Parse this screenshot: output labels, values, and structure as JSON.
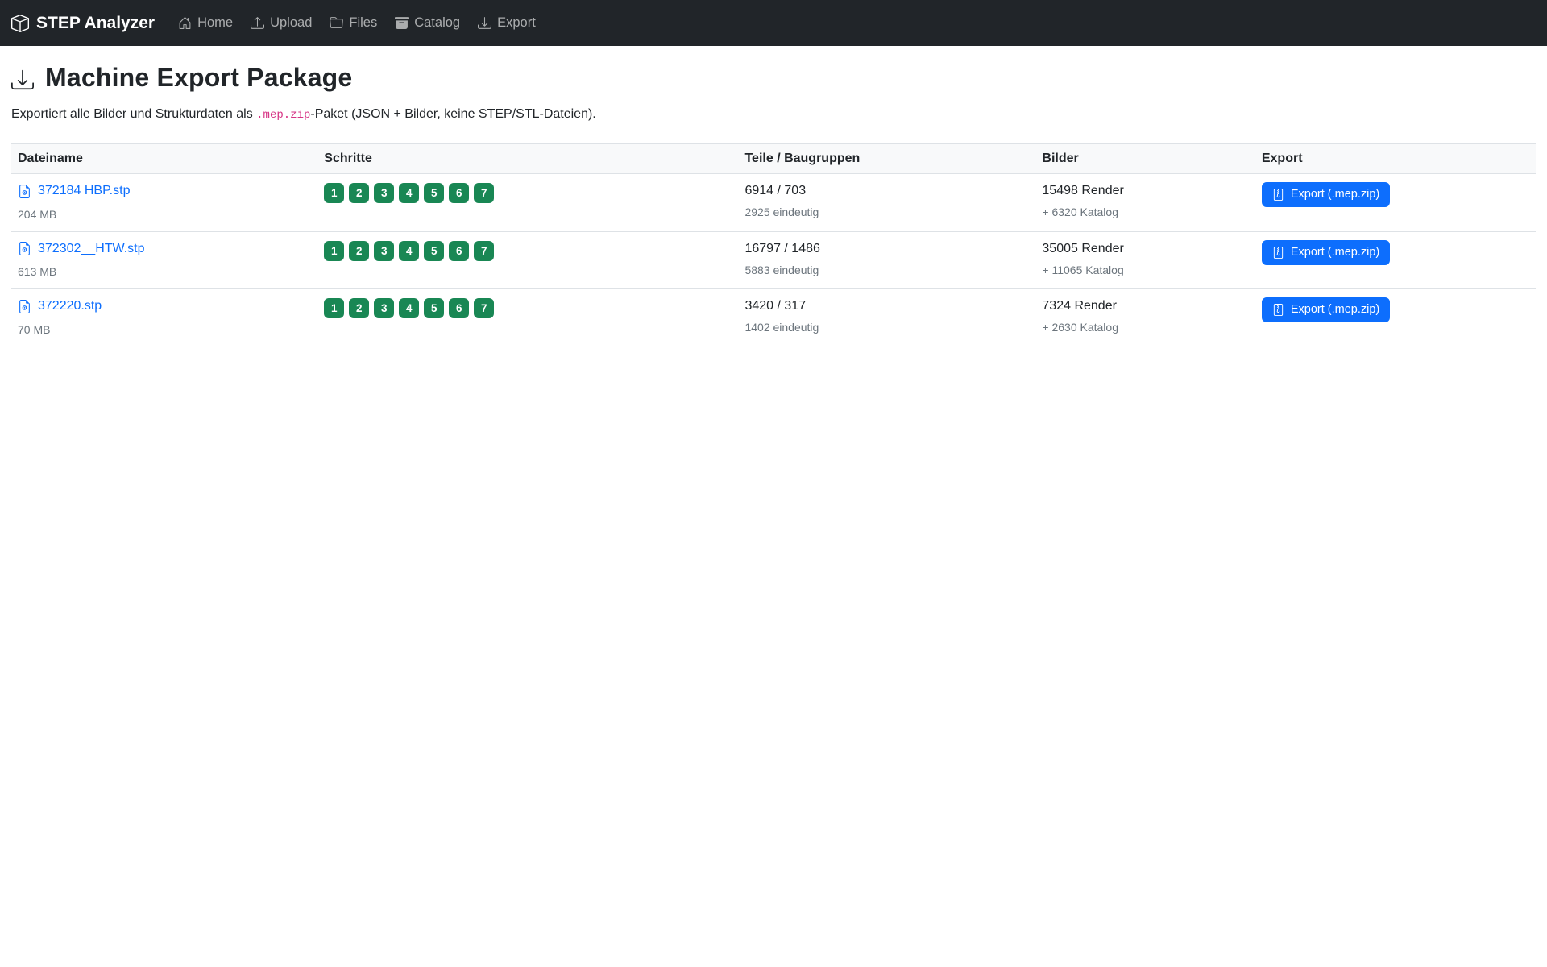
{
  "navbar": {
    "brand": "STEP Analyzer",
    "brand_icon": "box-3d-icon",
    "items": [
      {
        "label": "Home",
        "icon": "home-icon"
      },
      {
        "label": "Upload",
        "icon": "upload-icon"
      },
      {
        "label": "Files",
        "icon": "folder-icon"
      },
      {
        "label": "Catalog",
        "icon": "archive-icon"
      },
      {
        "label": "Export",
        "icon": "download-icon"
      }
    ]
  },
  "page": {
    "title": "Machine Export Package",
    "title_icon": "download-icon",
    "description": {
      "before": "Exportiert alle Bilder und Strukturdaten als ",
      "code": ".mep.zip",
      "after": "-Paket (JSON + Bilder, keine STEP/STL-Dateien)."
    }
  },
  "table": {
    "headers": [
      "Dateiname",
      "Schritte",
      "Teile / Baugruppen",
      "Bilder",
      "Export"
    ],
    "export_button_label": "Export (.mep.zip)",
    "export_button_icon": "zip-file-icon",
    "file_icon": "file-earmark-icon",
    "rows": [
      {
        "filename": "372184 HBP.stp",
        "filesize": "204 MB",
        "steps": [
          "1",
          "2",
          "3",
          "4",
          "5",
          "6",
          "7"
        ],
        "parts": "6914 / 703",
        "parts_unique": "2925 eindeutig",
        "images_render": "15498 Render",
        "images_catalog": "+ 6320 Katalog"
      },
      {
        "filename": "372302__HTW.stp",
        "filesize": "613 MB",
        "steps": [
          "1",
          "2",
          "3",
          "4",
          "5",
          "6",
          "7"
        ],
        "parts": "16797 / 1486",
        "parts_unique": "5883 eindeutig",
        "images_render": "35005 Render",
        "images_catalog": "+ 11065 Katalog"
      },
      {
        "filename": "372220.stp",
        "filesize": "70 MB",
        "steps": [
          "1",
          "2",
          "3",
          "4",
          "5",
          "6",
          "7"
        ],
        "parts": "3420 / 317",
        "parts_unique": "1402 eindeutig",
        "images_render": "7324 Render",
        "images_catalog": "+ 2630 Katalog"
      }
    ]
  },
  "colors": {
    "navbar_bg": "#212529",
    "link_blue": "#0d6efd",
    "button_blue": "#0d6efd",
    "badge_green": "#198754",
    "code_pink": "#d63384",
    "muted_gray": "#6c757d",
    "table_header_bg": "#f8f9fa",
    "border_gray": "#dee2e6"
  }
}
